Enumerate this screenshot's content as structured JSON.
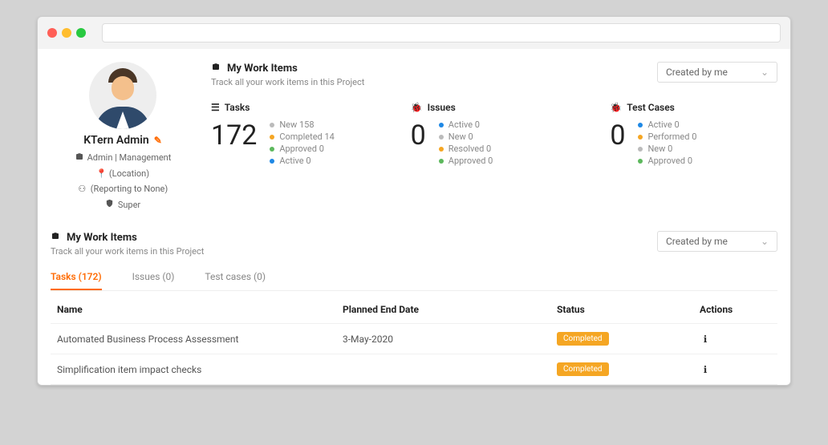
{
  "profile": {
    "name": "KTern Admin",
    "edit_icon": "pencil",
    "role": "Admin | Management",
    "location": "(Location)",
    "reporting": "(Reporting to None)",
    "level": "Super"
  },
  "workitems_top": {
    "title": "My Work Items",
    "subtitle": "Track all your work items in this Project",
    "filter": "Created by me"
  },
  "stats": {
    "tasks": {
      "label": "Tasks",
      "count": "172",
      "items": [
        {
          "class": "grey",
          "text": "New 158"
        },
        {
          "class": "orange",
          "text": "Completed 14"
        },
        {
          "class": "green",
          "text": "Approved 0"
        },
        {
          "class": "blue",
          "text": "Active 0"
        }
      ]
    },
    "issues": {
      "label": "Issues",
      "count": "0",
      "items": [
        {
          "class": "blue",
          "text": "Active 0"
        },
        {
          "class": "grey",
          "text": "New 0"
        },
        {
          "class": "orange",
          "text": "Resolved 0"
        },
        {
          "class": "green",
          "text": "Approved 0"
        }
      ]
    },
    "testcases": {
      "label": "Test Cases",
      "count": "0",
      "items": [
        {
          "class": "blue",
          "text": "Active 0"
        },
        {
          "class": "orange",
          "text": "Performed 0"
        },
        {
          "class": "grey",
          "text": "New 0"
        },
        {
          "class": "green",
          "text": "Approved 0"
        }
      ]
    }
  },
  "workitems_bottom": {
    "title": "My Work Items",
    "subtitle": "Track all your work items in this Project",
    "filter": "Created by me"
  },
  "tabs": [
    {
      "label": "Tasks (172)",
      "active": true
    },
    {
      "label": "Issues (0)",
      "active": false
    },
    {
      "label": "Test cases (0)",
      "active": false
    }
  ],
  "table": {
    "headers": {
      "name": "Name",
      "date": "Planned End Date",
      "status": "Status",
      "actions": "Actions"
    },
    "rows": [
      {
        "name": "Automated Business Process Assessment",
        "date": "3-May-2020",
        "status": "Completed"
      },
      {
        "name": "Simplification item impact checks",
        "date": "",
        "status": "Completed"
      }
    ]
  }
}
